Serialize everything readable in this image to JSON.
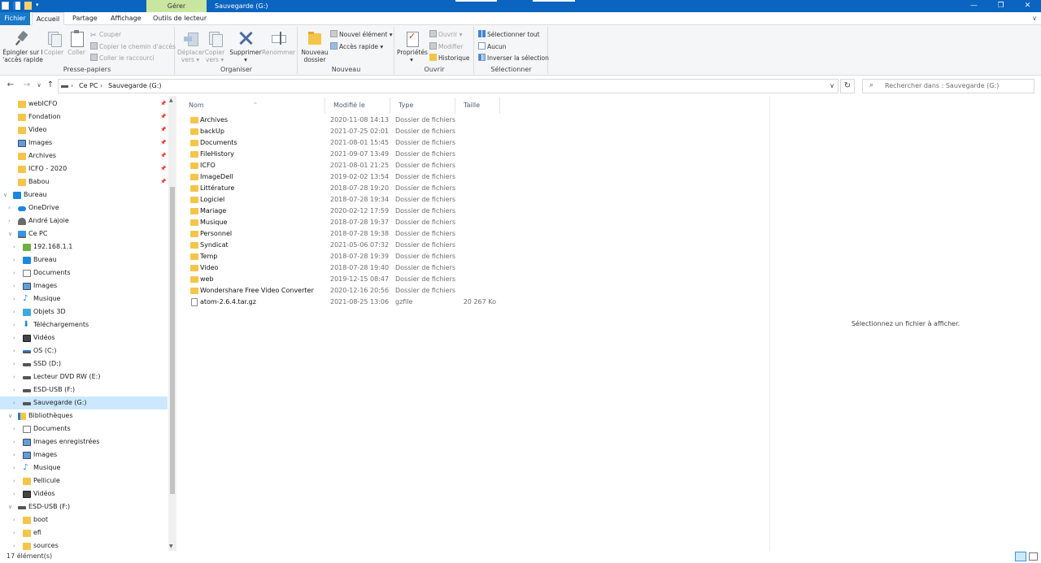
{
  "titlebar": {
    "context_tab": "Gérer",
    "title": "Sauvegarde (G:)",
    "minimize": "—",
    "maximize": "❐",
    "close": "✕"
  },
  "ribbon_tabs": {
    "fichier": "Fichier",
    "accueil": "Accueil",
    "partage": "Partage",
    "affichage": "Affichage",
    "outils": "Outils de lecteur",
    "expand_icon": "chevron-down-icon"
  },
  "ribbon": {
    "clipboard": {
      "label": "Presse-papiers",
      "pin_line1": "Épingler sur l",
      "pin_line2": "'accès rapide",
      "copy": "Copier",
      "paste": "Coller",
      "cut": "Couper",
      "copy_path": "Copier le chemin d'accès",
      "paste_shortcut": "Coller le raccourci"
    },
    "organize": {
      "label": "Organiser",
      "move_line1": "Déplacer",
      "move_line2": "vers ▾",
      "copy_line1": "Copier",
      "copy_line2": "vers ▾",
      "delete_line1": "Supprimer",
      "delete_line2": "▾",
      "rename": "Renommer"
    },
    "new": {
      "label": "Nouveau",
      "new_folder_line1": "Nouveau",
      "new_folder_line2": "dossier",
      "new_item": "Nouvel élément ▾",
      "quick_access": "Accès rapide ▾"
    },
    "open": {
      "label": "Ouvrir",
      "properties_line1": "Propriétés",
      "properties_line2": "▾",
      "open": "Ouvrir ▾",
      "edit": "Modifier",
      "history": "Historique"
    },
    "select": {
      "label": "Sélectionner",
      "select_all": "Sélectionner tout",
      "select_none": "Aucun",
      "invert": "Inverser la sélection"
    }
  },
  "address": {
    "back": "←",
    "forward": "→",
    "recent": "∨",
    "up": "↑",
    "sep": "›",
    "crumb_pc": "Ce PC",
    "crumb_drive": "Sauvegarde (G:)",
    "dropdown": "∨",
    "refresh": "↻",
    "search_icon": "⌕",
    "search_placeholder": "Rechercher dans : Sauvegarde (G:)"
  },
  "nav": {
    "items": [
      {
        "label": "webICFO",
        "icon": "folder",
        "pinned": true
      },
      {
        "label": "Fondation",
        "icon": "folder",
        "pinned": true
      },
      {
        "label": "Video",
        "icon": "folder",
        "pinned": true
      },
      {
        "label": "Images",
        "icon": "img",
        "pinned": true
      },
      {
        "label": "Archives",
        "icon": "folder",
        "pinned": true
      },
      {
        "label": "ICFO - 2020",
        "icon": "folder",
        "pinned": true
      },
      {
        "label": "Babou",
        "icon": "folder",
        "pinned": true
      },
      {
        "label": "Bureau",
        "icon": "desk",
        "expanded": true
      },
      {
        "label": "OneDrive",
        "icon": "cloud"
      },
      {
        "label": "André Lajoie",
        "icon": "user"
      },
      {
        "label": "Ce PC",
        "icon": "pc",
        "expanded": true
      },
      {
        "label": "192.168.1.1",
        "icon": "net"
      },
      {
        "label": "Bureau",
        "icon": "desk"
      },
      {
        "label": "Documents",
        "icon": "doc"
      },
      {
        "label": "Images",
        "icon": "img"
      },
      {
        "label": "Musique",
        "icon": "music"
      },
      {
        "label": "Objets 3D",
        "icon": "3d"
      },
      {
        "label": "Téléchargements",
        "icon": "down"
      },
      {
        "label": "Vidéos",
        "icon": "video"
      },
      {
        "label": "OS (C:)",
        "icon": "drive-os"
      },
      {
        "label": "SSD (D:)",
        "icon": "drive"
      },
      {
        "label": "Lecteur DVD RW (E:)",
        "icon": "drive"
      },
      {
        "label": "ESD-USB (F:)",
        "icon": "drive"
      },
      {
        "label": "Sauvegarde (G:)",
        "icon": "drive",
        "selected": true
      },
      {
        "label": "Bibliothèques",
        "icon": "lib",
        "expanded": true
      },
      {
        "label": "Documents",
        "icon": "doc"
      },
      {
        "label": "Images enregistrées",
        "icon": "img"
      },
      {
        "label": "Images",
        "icon": "img"
      },
      {
        "label": "Musique",
        "icon": "music"
      },
      {
        "label": "Pellicule",
        "icon": "folder"
      },
      {
        "label": "Vidéos",
        "icon": "video"
      },
      {
        "label": "ESD-USB (F:)",
        "icon": "drive",
        "expanded": true
      },
      {
        "label": "boot",
        "icon": "folder"
      },
      {
        "label": "efi",
        "icon": "folder"
      },
      {
        "label": "sources",
        "icon": "folder"
      }
    ]
  },
  "filelist": {
    "columns": {
      "name": "Nom",
      "date": "Modifié le",
      "type": "Type",
      "size": "Taille"
    },
    "rows": [
      {
        "name": "Archives",
        "date": "2020-11-08 14:13",
        "type": "Dossier de fichiers",
        "size": "",
        "kind": "folder"
      },
      {
        "name": "backUp",
        "date": "2021-07-25 02:01",
        "type": "Dossier de fichiers",
        "size": "",
        "kind": "folder"
      },
      {
        "name": "Documents",
        "date": "2021-08-01 15:45",
        "type": "Dossier de fichiers",
        "size": "",
        "kind": "folder"
      },
      {
        "name": "FileHistory",
        "date": "2021-09-07 13:49",
        "type": "Dossier de fichiers",
        "size": "",
        "kind": "folder"
      },
      {
        "name": "ICFO",
        "date": "2021-08-01 21:25",
        "type": "Dossier de fichiers",
        "size": "",
        "kind": "folder"
      },
      {
        "name": "ImageDell",
        "date": "2019-02-02 13:54",
        "type": "Dossier de fichiers",
        "size": "",
        "kind": "folder"
      },
      {
        "name": "Littérature",
        "date": "2018-07-28 19:20",
        "type": "Dossier de fichiers",
        "size": "",
        "kind": "folder"
      },
      {
        "name": "Logiciel",
        "date": "2018-07-28 19:34",
        "type": "Dossier de fichiers",
        "size": "",
        "kind": "folder"
      },
      {
        "name": "Mariage",
        "date": "2020-02-12 17:59",
        "type": "Dossier de fichiers",
        "size": "",
        "kind": "folder"
      },
      {
        "name": "Musique",
        "date": "2018-07-28 19:37",
        "type": "Dossier de fichiers",
        "size": "",
        "kind": "folder"
      },
      {
        "name": "Personnel",
        "date": "2018-07-28 19:38",
        "type": "Dossier de fichiers",
        "size": "",
        "kind": "folder"
      },
      {
        "name": "Syndicat",
        "date": "2021-05-06 07:32",
        "type": "Dossier de fichiers",
        "size": "",
        "kind": "folder"
      },
      {
        "name": "Temp",
        "date": "2018-07-28 19:39",
        "type": "Dossier de fichiers",
        "size": "",
        "kind": "folder"
      },
      {
        "name": "Video",
        "date": "2018-07-28 19:40",
        "type": "Dossier de fichiers",
        "size": "",
        "kind": "folder"
      },
      {
        "name": "web",
        "date": "2019-12-15 08:47",
        "type": "Dossier de fichiers",
        "size": "",
        "kind": "folder"
      },
      {
        "name": "Wondershare Free Video Converter",
        "date": "2020-12-16 20:56",
        "type": "Dossier de fichiers",
        "size": "",
        "kind": "folder"
      },
      {
        "name": "atom-2.6.4.tar.gz",
        "date": "2021-08-25 13:06",
        "type": "gzfile",
        "size": "20 267 Ko",
        "kind": "file"
      }
    ]
  },
  "preview": {
    "message": "Sélectionnez un fichier à afficher."
  },
  "status": {
    "count": "17 élément(s)"
  }
}
